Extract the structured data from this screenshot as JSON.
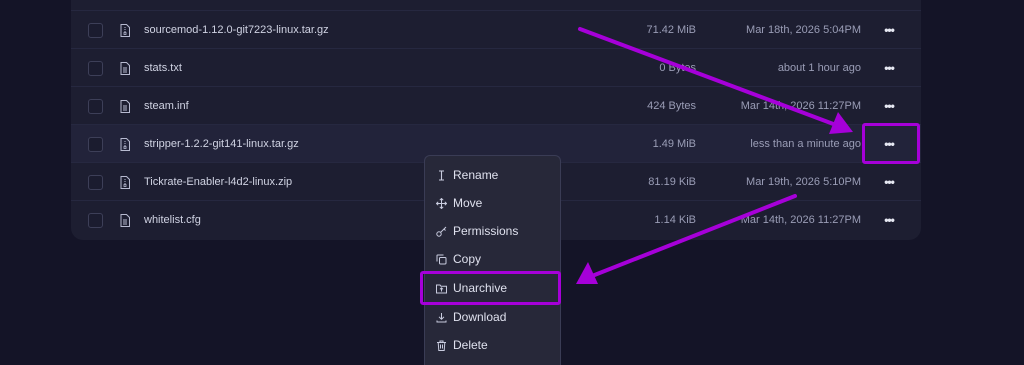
{
  "files": [
    {
      "name": "sourcemod-1.12.0-git7223-linux.tar.gz",
      "size": "71.42 MiB",
      "modified": "Mar 18th, 2026 5:04PM",
      "icon": "archive-file-icon"
    },
    {
      "name": "stats.txt",
      "size": "0 Bytes",
      "modified": "about 1 hour ago",
      "icon": "text-file-icon"
    },
    {
      "name": "steam.inf",
      "size": "424 Bytes",
      "modified": "Mar 14th, 2026 11:27PM",
      "icon": "text-file-icon"
    },
    {
      "name": "stripper-1.2.2-git141-linux.tar.gz",
      "size": "1.49 MiB",
      "modified": "less than a minute ago",
      "icon": "archive-file-icon"
    },
    {
      "name": "Tickrate-Enabler-l4d2-linux.zip",
      "size": "81.19 KiB",
      "modified": "Mar 19th, 2026 5:10PM",
      "icon": "archive-file-icon"
    },
    {
      "name": "whitelist.cfg",
      "size": "1.14 KiB",
      "modified": "Mar 14th, 2026 11:27PM",
      "icon": "text-file-icon"
    }
  ],
  "more_label": "•••",
  "context_menu": [
    {
      "label": "Rename",
      "icon": "rename-cursor-icon"
    },
    {
      "label": "Move",
      "icon": "move-arrows-icon"
    },
    {
      "label": "Permissions",
      "icon": "key-icon"
    },
    {
      "label": "Copy",
      "icon": "copy-icon"
    },
    {
      "label": "Unarchive",
      "icon": "unarchive-folder-icon"
    },
    {
      "label": "Download",
      "icon": "download-icon"
    },
    {
      "label": "Delete",
      "icon": "trash-icon"
    }
  ],
  "colors": {
    "highlight": "#a600d9",
    "background": "#141427",
    "panel": "#1d1e31"
  }
}
